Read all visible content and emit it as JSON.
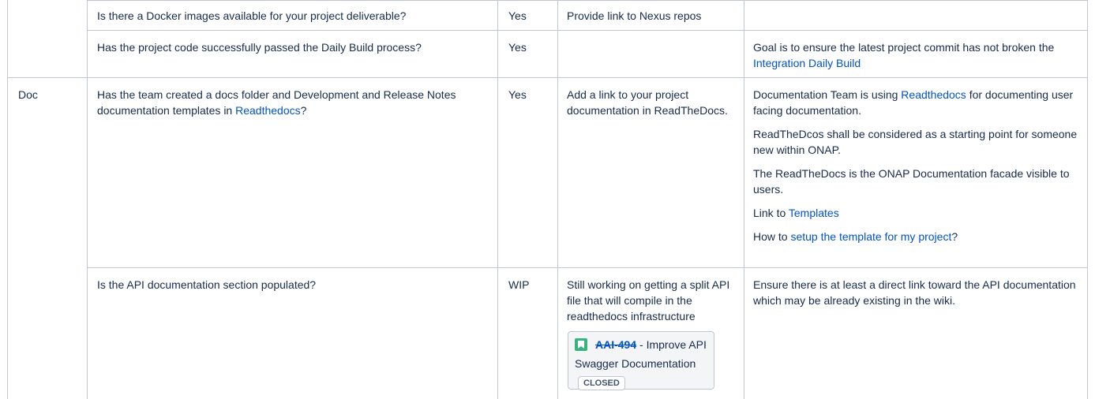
{
  "rows": [
    {
      "question": "Is there a Docker images available for your project deliverable?",
      "answer": "Yes",
      "evidence": "Provide link to Nexus repos"
    },
    {
      "question": "Has the project code successfully passed the Daily Build process?",
      "answer": "Yes",
      "comment": {
        "text": "Goal is to ensure the latest project commit has not broken the ",
        "link": "Integration Daily Build"
      }
    },
    {
      "area": "Doc",
      "question": {
        "text": "Has the team created a docs folder and Development and Release Notes documentation templates in ",
        "link": "Readthedocs",
        "suffix": "?"
      },
      "answer": "Yes",
      "evidence": "Add a link to your project documentation in ReadTheDocs.",
      "comment": {
        "p1_text": "Documentation Team is using ",
        "p1_link": "Readthedocs",
        "p1_suffix": " for documenting user facing documentation.",
        "p2": "ReadTheDcos shall be considered as a starting point for someone new within ONAP.",
        "p3": "The ReadTheDocs is the ONAP Documentation facade visible to users.",
        "p4_text": "Link to ",
        "p4_link": "Templates",
        "p5_text": "How to ",
        "p5_link": "setup the template for my project",
        "p5_suffix": "?"
      }
    },
    {
      "question": "Is the API documentation section populated?",
      "answer": "WIP",
      "evidence": "Still working on getting a split API file that will compile in the readthedocs infrastructure",
      "jira": {
        "key": "AAI-494",
        "summary": " - Improve API Swagger Documentation",
        "status": "CLOSED",
        "status_color": "#42526e",
        "icon": "story-icon",
        "icon_color": "#36b37e"
      },
      "comment": "Ensure there is at least a direct link toward the API documentation which may be already existing in the wiki."
    }
  ]
}
